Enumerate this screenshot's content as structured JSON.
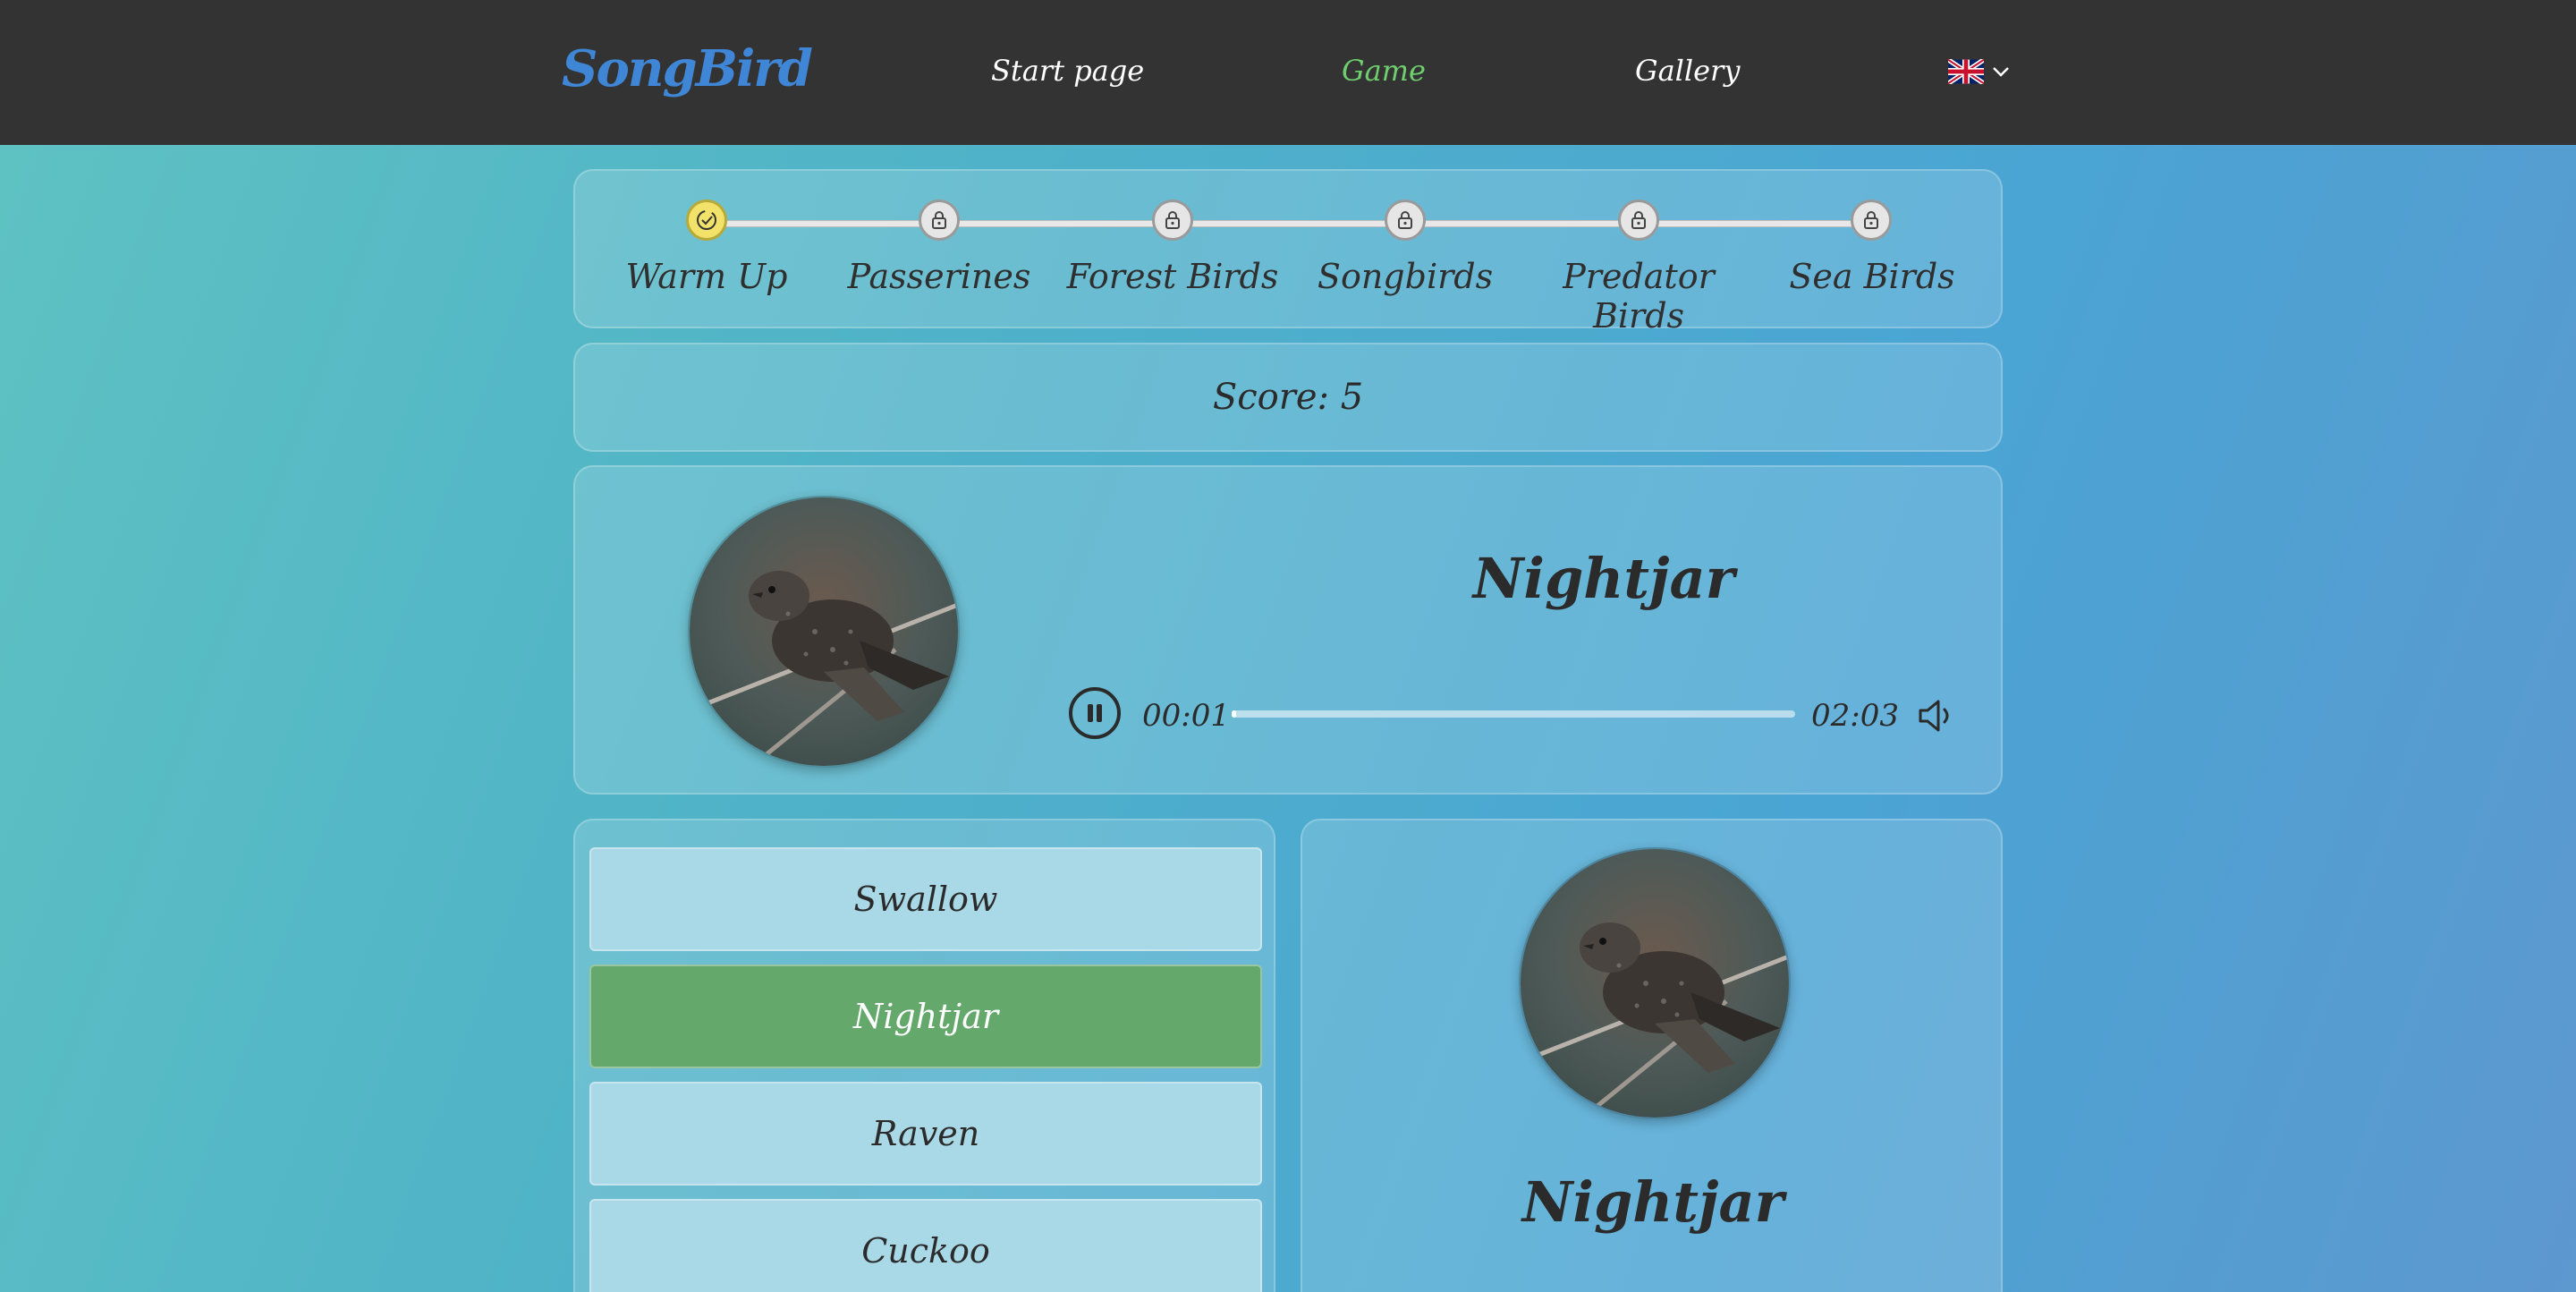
{
  "header": {
    "logo": "SongBird",
    "nav": [
      {
        "label": "Start page",
        "active": false
      },
      {
        "label": "Game",
        "active": true
      },
      {
        "label": "Gallery",
        "active": false
      }
    ],
    "language_icon": "uk-flag-icon",
    "colors": {
      "active_nav": "#6fcf6f",
      "logo": "#3f86d6",
      "header_bg": "#333333"
    }
  },
  "levels": [
    {
      "label": "Warm Up",
      "state": "done"
    },
    {
      "label": "Passerines",
      "state": "locked"
    },
    {
      "label": "Forest Birds",
      "state": "locked"
    },
    {
      "label": "Songbirds",
      "state": "locked"
    },
    {
      "label": "Predator Birds",
      "state": "locked"
    },
    {
      "label": "Sea Birds",
      "state": "locked"
    }
  ],
  "score": {
    "text": "Score: 5",
    "value": 5
  },
  "player": {
    "bird_name": "Nightjar",
    "current_time": "00:01",
    "duration": "02:03",
    "progress_fraction": 0.008,
    "state": "playing"
  },
  "answers": [
    {
      "label": "Swallow",
      "state": "default"
    },
    {
      "label": "Nightjar",
      "state": "correct"
    },
    {
      "label": "Raven",
      "state": "default"
    },
    {
      "label": "Cuckoo",
      "state": "default"
    }
  ],
  "info": {
    "bird_name": "Nightjar"
  }
}
